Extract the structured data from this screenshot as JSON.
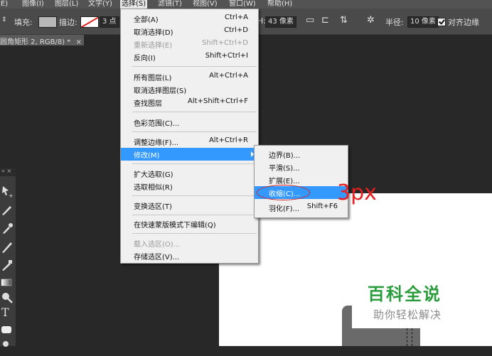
{
  "menubar": {
    "items": [
      {
        "label": "(E)"
      },
      {
        "label": "图像(I)"
      },
      {
        "label": "图层(L)"
      },
      {
        "label": "文字(Y)"
      },
      {
        "label": "选择(S)"
      },
      {
        "label": "滤镜(T)"
      },
      {
        "label": "视图(V)"
      },
      {
        "label": "窗口(W)"
      },
      {
        "label": "帮助(H)"
      }
    ]
  },
  "options": {
    "fill_label": "填充:",
    "stroke_label": "描边:",
    "stroke_width": "3 点",
    "height_prefix": "H:",
    "corner_value": "43 像素",
    "radius_label": "半径:",
    "radius_value": "10 像素",
    "align_edges_label": "对齐边缘",
    "align_edges_checked": true
  },
  "document_tab": {
    "title": "圆角矩形 2, RGB/8) *",
    "close": "×"
  },
  "tools_panel": {
    "header": "» ×",
    "type_tool_glyph": "T"
  },
  "select_menu": {
    "items": [
      {
        "label": "全部(A)",
        "shortcut": "Ctrl+A",
        "enabled": true
      },
      {
        "label": "取消选择(D)",
        "shortcut": "Ctrl+D",
        "enabled": true
      },
      {
        "label": "重新选择(E)",
        "shortcut": "Shift+Ctrl+D",
        "enabled": false
      },
      {
        "label": "反向(I)",
        "shortcut": "Shift+Ctrl+I",
        "enabled": true
      },
      {
        "label": "所有图层(L)",
        "shortcut": "Alt+Ctrl+A",
        "enabled": true
      },
      {
        "label": "取消选择图层(S)",
        "shortcut": "",
        "enabled": true
      },
      {
        "label": "查找图层",
        "shortcut": "Alt+Shift+Ctrl+F",
        "enabled": true
      },
      {
        "label": "色彩范围(C)...",
        "shortcut": "",
        "enabled": true
      },
      {
        "label": "调整边缘(F)...",
        "shortcut": "Alt+Ctrl+R",
        "enabled": true
      },
      {
        "label": "修改(M)",
        "shortcut": "",
        "enabled": true,
        "highlighted": true
      },
      {
        "label": "扩大选取(G)",
        "shortcut": "",
        "enabled": true
      },
      {
        "label": "选取相似(R)",
        "shortcut": "",
        "enabled": true
      },
      {
        "label": "变换选区(T)",
        "shortcut": "",
        "enabled": true
      },
      {
        "label": "在快速蒙版模式下编辑(Q)",
        "shortcut": "",
        "enabled": true
      },
      {
        "label": "载入选区(O)...",
        "shortcut": "",
        "enabled": false
      },
      {
        "label": "存储选区(V)...",
        "shortcut": "",
        "enabled": true
      }
    ]
  },
  "modify_submenu": {
    "items": [
      {
        "label": "边界(B)...",
        "shortcut": ""
      },
      {
        "label": "平滑(S)...",
        "shortcut": ""
      },
      {
        "label": "扩展(E)...",
        "shortcut": ""
      },
      {
        "label": "收缩(C)...",
        "shortcut": "",
        "highlighted": true
      },
      {
        "label": "羽化(F)...",
        "shortcut": "Shift+F6"
      }
    ]
  },
  "annotation": {
    "text": "3px",
    "color": "#e62020"
  },
  "watermark": {
    "title": "百科全说",
    "subtitle": "助你轻松解决",
    "title_color": "#2a9c3c"
  },
  "colors": {
    "menu_highlight": "#3399ff",
    "workspace": "#282828",
    "menubar": "#535353"
  }
}
